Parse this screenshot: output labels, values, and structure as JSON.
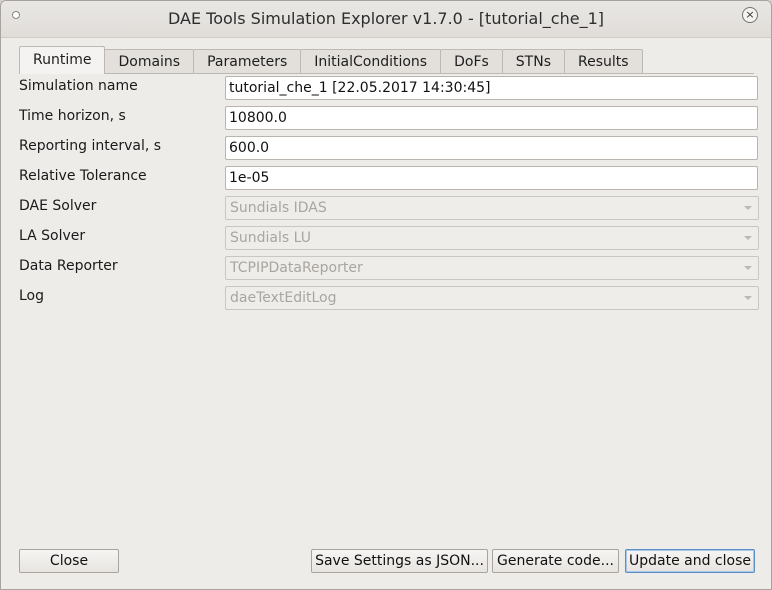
{
  "window": {
    "title": "DAE Tools Simulation Explorer v1.7.0 - [tutorial_che_1]",
    "close_glyph": "×"
  },
  "tabs": [
    {
      "label": "Runtime",
      "active": true
    },
    {
      "label": "Domains"
    },
    {
      "label": "Parameters"
    },
    {
      "label": "InitialConditions"
    },
    {
      "label": "DoFs"
    },
    {
      "label": "STNs"
    },
    {
      "label": "Results"
    }
  ],
  "form": {
    "simulation_name": {
      "label": "Simulation name",
      "value": "tutorial_che_1 [22.05.2017 14:30:45]"
    },
    "time_horizon": {
      "label": "Time horizon, s",
      "value": "10800.0"
    },
    "reporting_interval": {
      "label": "Reporting interval, s",
      "value": "600.0"
    },
    "relative_tolerance": {
      "label": "Relative Tolerance",
      "value": "1e-05"
    },
    "dae_solver": {
      "label": "DAE Solver",
      "value": "Sundials IDAS"
    },
    "la_solver": {
      "label": "LA Solver",
      "value": "Sundials LU"
    },
    "data_reporter": {
      "label": "Data Reporter",
      "value": "TCPIPDataReporter"
    },
    "log": {
      "label": "Log",
      "value": "daeTextEditLog"
    }
  },
  "buttons": {
    "close": "Close",
    "save_settings": "Save Settings as JSON...",
    "generate_code": "Generate code...",
    "update_and_close": "Update and close"
  },
  "colors": {
    "window_bg": "#eeece9",
    "default_button_border": "#5c8fc4"
  }
}
